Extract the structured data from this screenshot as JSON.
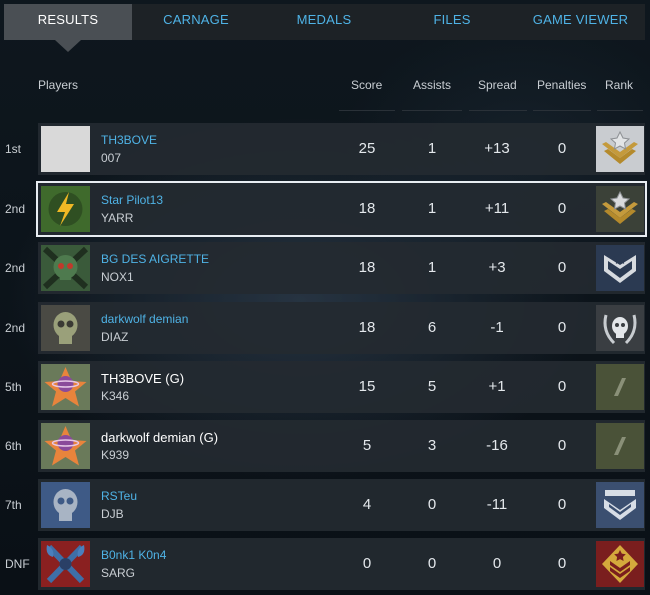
{
  "tabs": [
    "RESULTS",
    "CARNAGE",
    "MEDALS",
    "FILES",
    "GAME VIEWER"
  ],
  "columns": {
    "players": "Players",
    "score": "Score",
    "assists": "Assists",
    "spread": "Spread",
    "penalties": "Penalties",
    "rank": "Rank"
  },
  "rows": [
    {
      "place": "1st",
      "gamertag": "TH3BOVE",
      "service_tag": "007",
      "score": "25",
      "assists": "1",
      "spread": "+13",
      "penalties": "0",
      "emblem": "blank-emblem",
      "rank_icon": "gold-wings-rank-icon"
    },
    {
      "place": "2nd",
      "gamertag": "Star Pilot13",
      "service_tag": "YARR",
      "score": "18",
      "assists": "1",
      "spread": "+11",
      "penalties": "0",
      "emblem": "lightning-bolt-emblem",
      "rank_icon": "gold-wings-rank-icon"
    },
    {
      "place": "2nd",
      "gamertag": "BG DES AIGRETTE",
      "service_tag": "NOX1",
      "score": "18",
      "assists": "1",
      "spread": "+3",
      "penalties": "0",
      "emblem": "skull-emblem",
      "rank_icon": "silver-star-chevron-rank-icon"
    },
    {
      "place": "2nd",
      "gamertag": "darkwolf demian",
      "service_tag": "DIAZ",
      "score": "18",
      "assists": "6",
      "spread": "-1",
      "penalties": "0",
      "emblem": "skull-emblem",
      "rank_icon": "silver-skull-wreath-rank-icon"
    },
    {
      "place": "5th",
      "gamertag": "TH3BOVE (G)",
      "service_tag": "K346",
      "score": "15",
      "assists": "5",
      "spread": "+1",
      "penalties": "0",
      "emblem": "star-planet-emblem",
      "rank_icon": "stripe-rank-icon"
    },
    {
      "place": "6th",
      "gamertag": "darkwolf demian (G)",
      "service_tag": "K939",
      "score": "5",
      "assists": "3",
      "spread": "-16",
      "penalties": "0",
      "emblem": "star-planet-emblem",
      "rank_icon": "stripe-rank-icon"
    },
    {
      "place": "7th",
      "gamertag": "RSTeu",
      "service_tag": "DJB",
      "score": "4",
      "assists": "0",
      "spread": "-11",
      "penalties": "0",
      "emblem": "skull-emblem",
      "rank_icon": "blue-chevron-rank-icon"
    },
    {
      "place": "DNF",
      "gamertag": "B0nk1 K0n4",
      "service_tag": "SARG",
      "score": "0",
      "assists": "0",
      "spread": "0",
      "penalties": "0",
      "emblem": "crossed-axes-emblem",
      "rank_icon": "gold-chevron-rank-icon"
    }
  ]
}
